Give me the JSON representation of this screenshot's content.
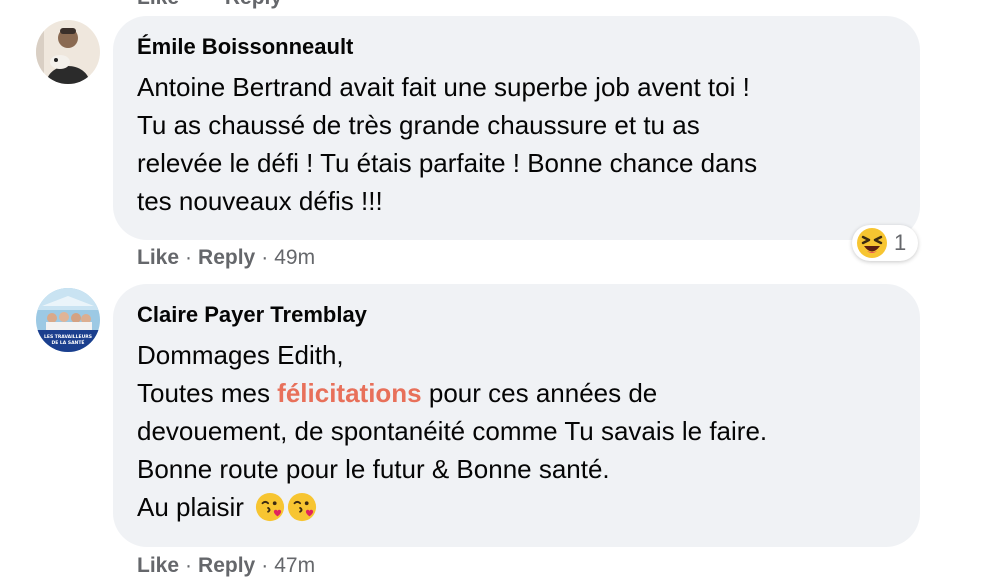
{
  "top_cutoff": {
    "like_label": "Like",
    "reply_label": "Reply"
  },
  "comments": [
    {
      "author": "Émile Boissonneault",
      "lines": [
        "Antoine Bertrand avait fait une superbe job avent toi !",
        "Tu as chaussé de très grande chaussure et tu as",
        "relevée le défi ! Tu étais parfaite ! Bonne chance dans",
        "tes nouveaux défis !!!"
      ],
      "reaction": {
        "icon": "laughing-squinting-emoji-icon",
        "count": "1"
      },
      "like_label": "Like",
      "reply_label": "Reply",
      "timestamp": "49m"
    },
    {
      "author": "Claire Payer Tremblay",
      "line1": "Dommages Edith,",
      "line2_before": "Toutes mes ",
      "line2_highlight": "félicitations",
      "line2_after": " pour ces années de",
      "line3": "devouement, de spontanéité comme Tu savais le faire.",
      "line4": "Bonne route pour le futur & Bonne santé.",
      "line5": "Au plaisir",
      "emojis": [
        "kissing-heart-emoji-icon",
        "kissing-heart-emoji-icon"
      ],
      "avatar_badge": "LES TRAVAILLEURS DE LA SANTÉ",
      "like_label": "Like",
      "reply_label": "Reply",
      "timestamp": "47m"
    }
  ],
  "separator": "·",
  "colors": {
    "bubble": "#f0f2f5",
    "meta": "#65676b",
    "highlight": "#e8705a",
    "text": "#050505"
  }
}
